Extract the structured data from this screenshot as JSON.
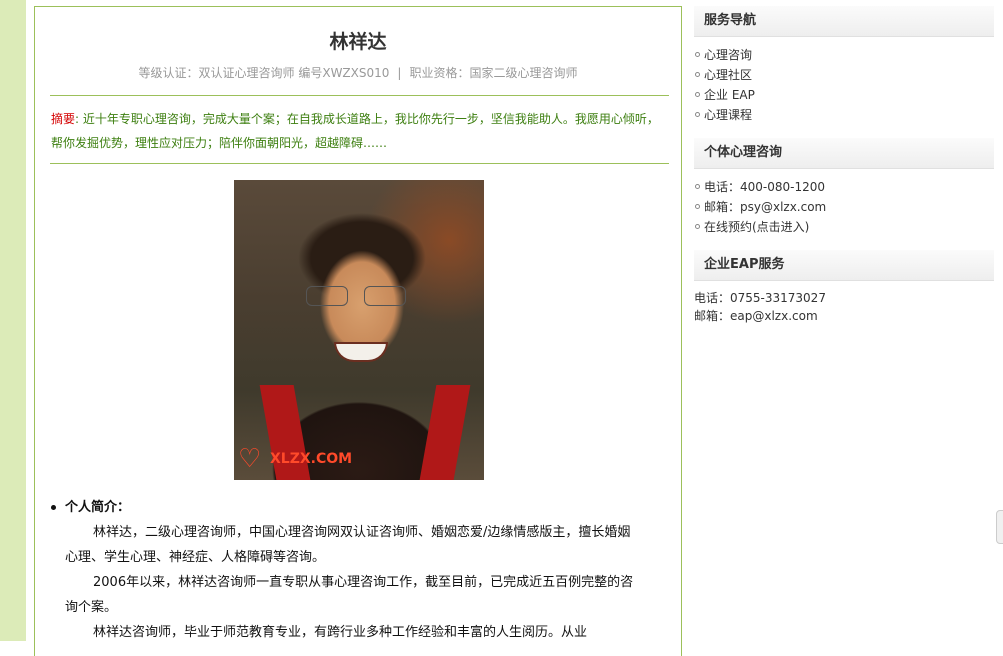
{
  "profile": {
    "name": "林祥达",
    "meta_left": "等级认证：双认证心理咨询师 编号XWZXS010",
    "meta_sep": "|",
    "meta_right": "职业资格：国家二级心理咨询师",
    "summary_label": "摘要",
    "summary_text": ": 近十年专职心理咨询，完成大量个案；在自我成长道路上，我比你先行一步，坚信我能助人。我愿用心倾听，帮你发掘优势，理性应对压力；陪伴你面朝阳光，超越障碍……",
    "watermark": "XLZX.COM",
    "bio_heading": "个人简介：",
    "bio_paragraphs": [
      "林祥达，二级心理咨询师，中国心理咨询网双认证咨询师、婚姻恋爱/边缘情感版主，擅长婚姻心理、学生心理、神经症、人格障碍等咨询。",
      "2006年以来，林祥达咨询师一直专职从事心理咨询工作，截至目前，已完成近五百例完整的咨询个案。",
      "林祥达咨询师，毕业于师范教育专业，有跨行业多种工作经验和丰富的人生阅历。从业"
    ]
  },
  "sidebar": {
    "nav_title": "服务导航",
    "nav_items": [
      "心理咨询",
      "心理社区",
      "企业 EAP",
      "心理课程"
    ],
    "personal_title": "个体心理咨询",
    "personal_items": [
      "电话：400-080-1200",
      "邮箱：psy@xlzx.com",
      "在线预约(点击进入)"
    ],
    "eap_title": "企业EAP服务",
    "eap_phone": "电话：0755-33173027",
    "eap_email": "邮箱：eap@xlzx.com"
  },
  "colors": {
    "accent_green": "#9cc05a",
    "summary_green": "#3d7f10",
    "summary_label_red": "#d40000",
    "left_band": "#dcebb8"
  }
}
